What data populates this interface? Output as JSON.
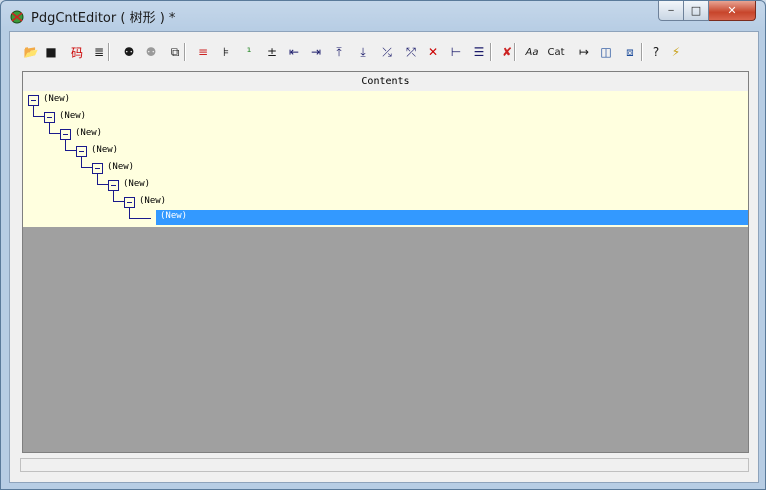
{
  "window": {
    "title": "PdgCntEditor ( 树形 ) *",
    "minimize_glyph": "‒",
    "maximize_glyph": "□",
    "close_glyph": "✕"
  },
  "toolbar": {
    "tools": [
      {
        "name": "open-icon",
        "glyph": "📂",
        "color": "#c89018"
      },
      {
        "name": "save-icon",
        "glyph": "■",
        "color": "#1a1a1a"
      },
      {
        "name": "encoding-icon",
        "glyph": "码",
        "color": "#cc0000"
      },
      {
        "name": "notepad-icon",
        "glyph": "≣",
        "color": "#1a1a1a"
      },
      {
        "name": "find-icon",
        "glyph": "⚉",
        "color": "#1a1a1a"
      },
      {
        "name": "find-next-icon",
        "glyph": "⚉",
        "color": "#9a9a9a"
      },
      {
        "name": "replace-icon",
        "glyph": "⧉",
        "color": "#1a1a1a"
      },
      {
        "name": "align-text-icon",
        "glyph": "≡",
        "color": "#cc2222"
      },
      {
        "name": "list-indent-icon",
        "glyph": "⊧",
        "color": "#1a1a1a"
      },
      {
        "name": "page-number-icon",
        "glyph": "¹",
        "color": "#2a8a2a"
      },
      {
        "name": "plus-minus-icon",
        "glyph": "±",
        "color": "#1a1a1a"
      },
      {
        "name": "indent-left-icon",
        "glyph": "⇤",
        "color": "#1a1a6a"
      },
      {
        "name": "indent-right-icon",
        "glyph": "⇥",
        "color": "#1a1a6a"
      },
      {
        "name": "move-up-icon",
        "glyph": "⤒",
        "color": "#1a1a6a"
      },
      {
        "name": "move-down-icon",
        "glyph": "⤓",
        "color": "#1a1a6a"
      },
      {
        "name": "insert-before-icon",
        "glyph": "⤰",
        "color": "#1a1a6a"
      },
      {
        "name": "insert-after-icon",
        "glyph": "⤱",
        "color": "#1a1a6a"
      },
      {
        "name": "delete-icon",
        "glyph": "✕",
        "color": "#cc0000"
      },
      {
        "name": "tree-view-icon",
        "glyph": "⊢",
        "color": "#1a1a6a"
      },
      {
        "name": "list-view-icon",
        "glyph": "☰",
        "color": "#1a1a6a"
      },
      {
        "name": "pdf-icon",
        "glyph": "✘",
        "color": "#cc2222"
      },
      {
        "name": "font-icon",
        "glyph": "Aa",
        "color": "#1a1a1a"
      },
      {
        "name": "catalog-icon",
        "glyph": "Cat",
        "color": "#1a1a1a"
      },
      {
        "name": "link-icon",
        "glyph": "↦",
        "color": "#1a1a1a"
      },
      {
        "name": "split-icon",
        "glyph": "◫",
        "color": "#1a4a9a"
      },
      {
        "name": "preview-icon",
        "glyph": "⧈",
        "color": "#1a4a9a"
      },
      {
        "name": "help-icon",
        "glyph": "?",
        "color": "#1a1a1a"
      },
      {
        "name": "magic-icon",
        "glyph": "⚡",
        "color": "#c8a018"
      }
    ]
  },
  "tree": {
    "header": "Contents",
    "nodes": [
      {
        "label": "(New)",
        "level": 0
      },
      {
        "label": "(New)",
        "level": 1
      },
      {
        "label": "(New)",
        "level": 2
      },
      {
        "label": "(New)",
        "level": 3
      },
      {
        "label": "(New)",
        "level": 4
      },
      {
        "label": "(New)",
        "level": 5
      },
      {
        "label": "(New)",
        "level": 6
      }
    ],
    "selected": {
      "label": "(New)",
      "level": 7
    }
  },
  "status": {
    "text": ""
  }
}
